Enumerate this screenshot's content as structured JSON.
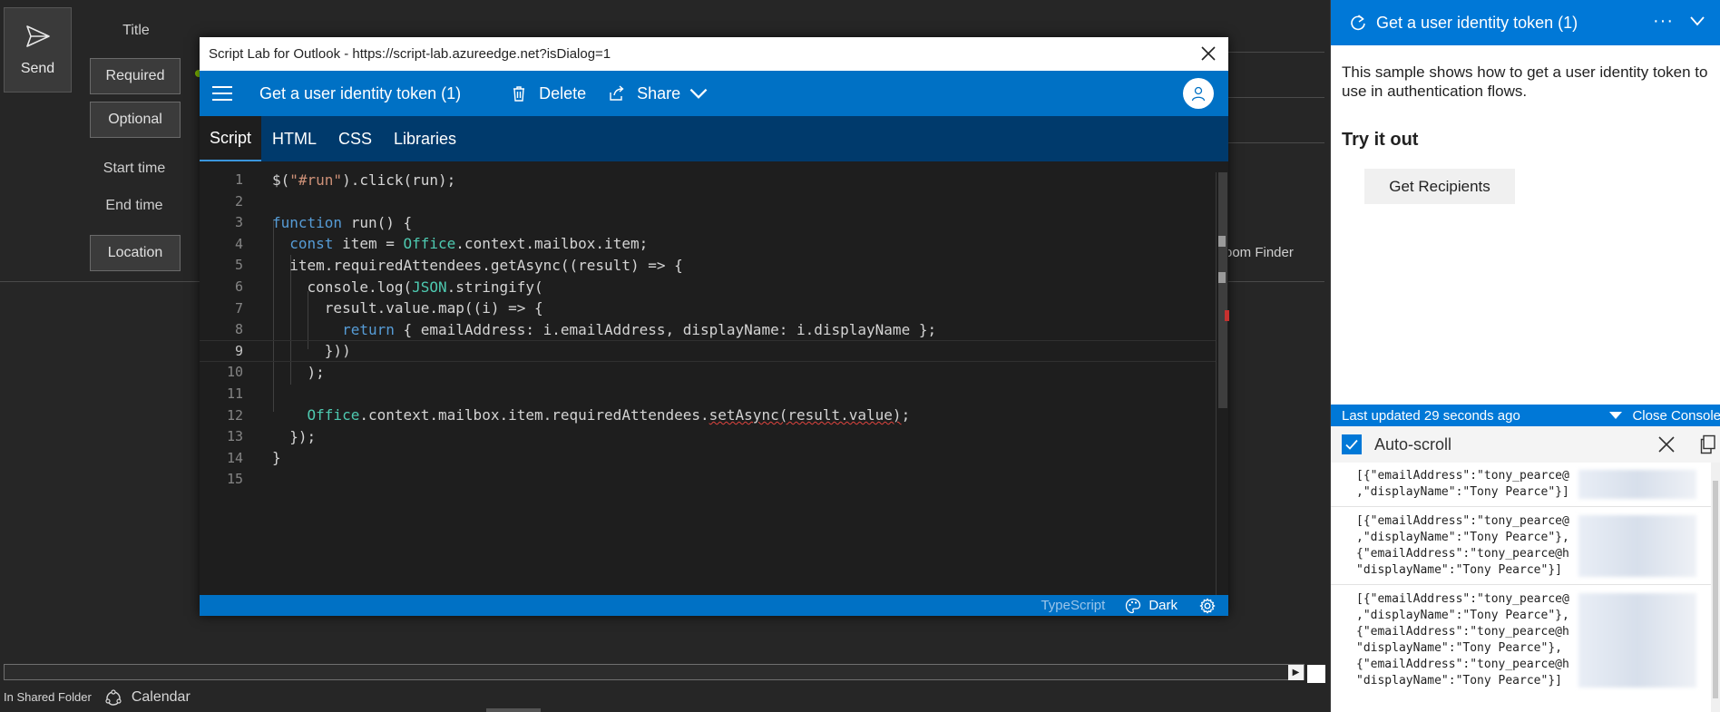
{
  "outlook": {
    "send_label": "Send",
    "title_label": "Title",
    "required_label": "Required",
    "optional_label": "Optional",
    "start_time_label": "Start time",
    "end_time_label": "End time",
    "location_label": "Location",
    "room_finder_label": "oom Finder",
    "status_folder": "In Shared Folder",
    "status_calendar": "Calendar"
  },
  "dialog": {
    "window_title": "Script Lab for Outlook - https://script-lab.azureedge.net?isDialog=1",
    "snippet_name": "Get a user identity token (1)",
    "delete_label": "Delete",
    "share_label": "Share",
    "tabs": [
      {
        "label": "Script",
        "active": true
      },
      {
        "label": "HTML",
        "active": false
      },
      {
        "label": "CSS",
        "active": false
      },
      {
        "label": "Libraries",
        "active": false
      }
    ],
    "current_line": 9,
    "footer_language": "TypeScript",
    "footer_theme": "Dark"
  },
  "pane": {
    "title": "Get a user identity token (1)",
    "description": "This sample shows how to get a user identity token to use in authentication flows.",
    "try_heading": "Try it out",
    "button_label": "Get Recipients",
    "last_updated": "Last updated 29 seconds ago",
    "close_console_label": "Close Console",
    "autoscroll_label": "Auto-scroll",
    "autoscroll_checked": true,
    "log_entries": [
      [
        "[{\"emailAddress\":\"tony_pearce@",
        ",\"displayName\":\"Tony Pearce\"}]"
      ],
      [
        "[{\"emailAddress\":\"tony_pearce@",
        ",\"displayName\":\"Tony Pearce\"},",
        "{\"emailAddress\":\"tony_pearce@h",
        "\"displayName\":\"Tony Pearce\"}]"
      ],
      [
        "[{\"emailAddress\":\"tony_pearce@",
        ",\"displayName\":\"Tony Pearce\"},",
        "{\"emailAddress\":\"tony_pearce@h",
        "\"displayName\":\"Tony Pearce\"},",
        "{\"emailAddress\":\"tony_pearce@h",
        "\"displayName\":\"Tony Pearce\"}]"
      ]
    ]
  },
  "colors": {
    "accent_blue": "#0078d7",
    "dialog_blue": "#0071c5",
    "tab_bar": "#003a6c",
    "editor_bg": "#1e1e1e",
    "keyword": "#569cd6",
    "string": "#ce9178",
    "class": "#4ec9b0"
  },
  "code_lines": [
    [
      [
        "p",
        "$("
      ],
      [
        "s",
        "\"#run\""
      ],
      [
        "p",
        ").click(run);"
      ]
    ],
    [],
    [
      [
        "k",
        "function"
      ],
      [
        "p",
        " run() {"
      ]
    ],
    [
      [
        "p",
        "  "
      ],
      [
        "k",
        "const"
      ],
      [
        "p",
        " item = "
      ],
      [
        "c",
        "Office"
      ],
      [
        "p",
        ".context.mailbox.item;"
      ]
    ],
    [
      [
        "p",
        "  item.requiredAttendees.getAsync((result) => {"
      ]
    ],
    [
      [
        "p",
        "    console.log("
      ],
      [
        "c",
        "JSON"
      ],
      [
        "p",
        ".stringify("
      ]
    ],
    [
      [
        "p",
        "      result.value.map((i) => {"
      ]
    ],
    [
      [
        "p",
        "        "
      ],
      [
        "k",
        "return"
      ],
      [
        "p",
        " { emailAddress: i.emailAddress, displayName: i.displayName };"
      ]
    ],
    [
      [
        "p",
        "      }))"
      ]
    ],
    [
      [
        "p",
        "    );"
      ]
    ],
    [],
    [
      [
        "p",
        "    "
      ],
      [
        "c",
        "Office"
      ],
      [
        "p",
        ".context.mailbox.item.requiredAttendees."
      ],
      [
        "q",
        "setAsync(result.value)"
      ],
      [
        "p",
        ";"
      ]
    ],
    [
      [
        "p",
        "  });"
      ]
    ],
    [
      [
        "p",
        "}"
      ]
    ],
    []
  ]
}
